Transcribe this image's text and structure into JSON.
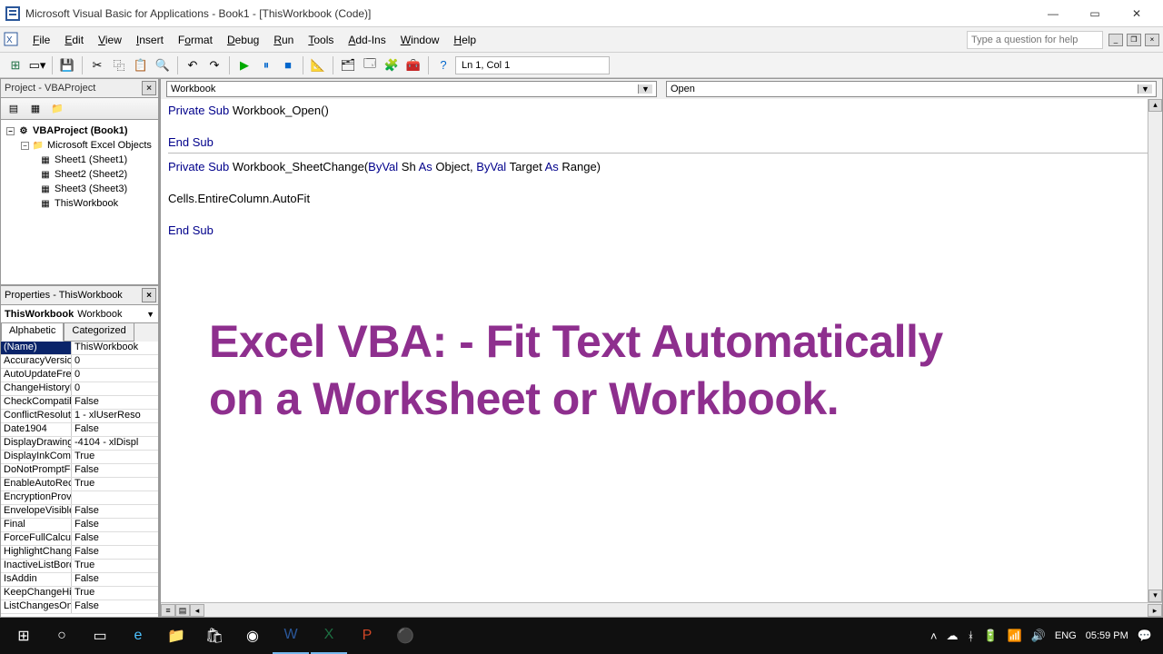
{
  "titlebar": {
    "text": "Microsoft Visual Basic for Applications - Book1 - [ThisWorkbook (Code)]"
  },
  "menubar": {
    "items": [
      "File",
      "Edit",
      "View",
      "Insert",
      "Format",
      "Debug",
      "Run",
      "Tools",
      "Add-Ins",
      "Window",
      "Help"
    ],
    "help_placeholder": "Type a question for help"
  },
  "toolbar": {
    "position": "Ln 1, Col 1"
  },
  "project_panel": {
    "title": "Project - VBAProject",
    "root": "VBAProject (Book1)",
    "folder": "Microsoft Excel Objects",
    "items": [
      "Sheet1 (Sheet1)",
      "Sheet2 (Sheet2)",
      "Sheet3 (Sheet3)",
      "ThisWorkbook"
    ]
  },
  "properties_panel": {
    "title": "Properties - ThisWorkbook",
    "object_bold": "ThisWorkbook",
    "object_type": "Workbook",
    "tabs": [
      "Alphabetic",
      "Categorized"
    ],
    "rows": [
      {
        "n": "(Name)",
        "v": "ThisWorkbook",
        "sel": true
      },
      {
        "n": "AccuracyVersion",
        "v": "0"
      },
      {
        "n": "AutoUpdateFreq",
        "v": "0"
      },
      {
        "n": "ChangeHistoryD",
        "v": "0"
      },
      {
        "n": "CheckCompatibili",
        "v": "False"
      },
      {
        "n": "ConflictResolutio",
        "v": "1 - xlUserReso"
      },
      {
        "n": "Date1904",
        "v": "False"
      },
      {
        "n": "DisplayDrawingO",
        "v": "-4104 - xlDispl"
      },
      {
        "n": "DisplayInkComm",
        "v": "True"
      },
      {
        "n": "DoNotPromptFo",
        "v": "False"
      },
      {
        "n": "EnableAutoReco",
        "v": "True"
      },
      {
        "n": "EncryptionProvi",
        "v": ""
      },
      {
        "n": "EnvelopeVisible",
        "v": "False"
      },
      {
        "n": "Final",
        "v": "False"
      },
      {
        "n": "ForceFullCalcula",
        "v": "False"
      },
      {
        "n": "HighlightChange",
        "v": "False"
      },
      {
        "n": "InactiveListBord",
        "v": "True"
      },
      {
        "n": "IsAddin",
        "v": "False"
      },
      {
        "n": "KeepChangeHis",
        "v": "True"
      },
      {
        "n": "ListChangesOnN",
        "v": "False"
      }
    ]
  },
  "code": {
    "dd_left": "Workbook",
    "dd_right": "Open",
    "sub1_sig": "Private Sub Workbook_Open()",
    "end_sub": "End Sub",
    "sub2_a": "Private Sub Workbook_SheetChange(",
    "sub2_b": "ByVal Sh As Object, ByVal Target As Range",
    "sub2_c": ")",
    "body2": "Cells.EntireColumn.AutoFit",
    "kw_private": "Private",
    "kw_sub": "Sub",
    "kw_end": "End",
    "kw_byval": "ByVal",
    "kw_as": "As"
  },
  "overlay": {
    "line1": "Excel VBA: - Fit Text Automatically",
    "line2": "on a Worksheet or Workbook."
  },
  "taskbar": {
    "time": "05:59 PM",
    "lang": "ENG"
  }
}
